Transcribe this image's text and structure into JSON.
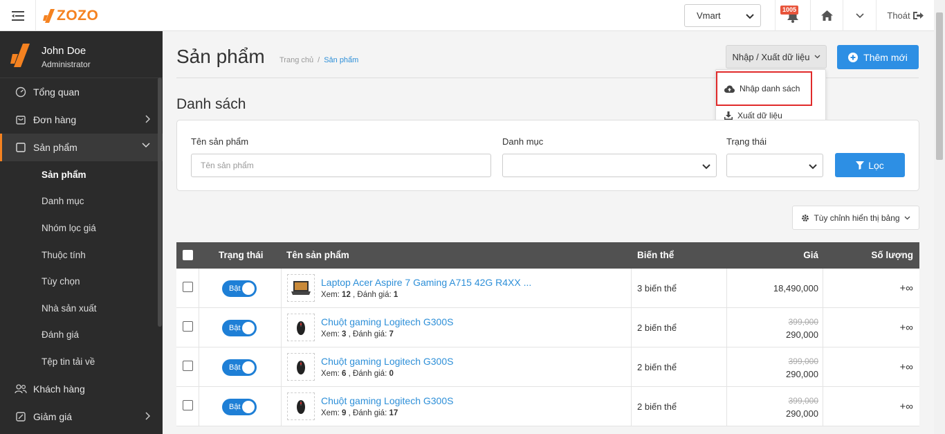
{
  "header": {
    "logo_text": "ZOZO",
    "store_select": "Vmart",
    "notification_count": "1005",
    "logout_label": "Thoát"
  },
  "user": {
    "name": "John Doe",
    "role": "Administrator"
  },
  "sidebar": {
    "items": [
      {
        "label": "Tổng quan",
        "icon": "dashboard-icon"
      },
      {
        "label": "Đơn hàng",
        "icon": "orders-icon"
      },
      {
        "label": "Sản phẩm",
        "icon": "products-icon"
      },
      {
        "label": "Khách hàng",
        "icon": "customers-icon"
      },
      {
        "label": "Giảm giá",
        "icon": "discount-icon"
      }
    ],
    "subitems": [
      "Sản phẩm",
      "Danh mục",
      "Nhóm lọc giá",
      "Thuộc tính",
      "Tùy chọn",
      "Nhà sản xuất",
      "Đánh giá",
      "Tệp tin tải về"
    ]
  },
  "page": {
    "title": "Sản phẩm",
    "breadcrumb": [
      "Trang chủ",
      "/",
      "Sản phẩm"
    ],
    "import_export_label": "Nhập / Xuất dữ liệu",
    "add_new_label": "Thêm mới",
    "dropdown": {
      "import_label": "Nhập danh sách",
      "export_label": "Xuất dữ liệu"
    },
    "section_title": "Danh sách"
  },
  "filters": {
    "name_label": "Tên sản phẩm",
    "name_placeholder": "Tên sản phẩm",
    "category_label": "Danh mục",
    "status_label": "Trạng thái",
    "filter_button": "Lọc",
    "customize_button": "Tùy chỉnh hiển thị bảng"
  },
  "table": {
    "headers": {
      "status": "Trạng thái",
      "name": "Tên sản phẩm",
      "variants": "Biến thể",
      "price": "Giá",
      "quantity": "Số lượng"
    },
    "views_label": "Xem:",
    "rating_label": ", Đánh giá:",
    "rows": [
      {
        "status": "Bật",
        "name": "Laptop Acer Aspire 7 Gaming A715 42G R4XX ...",
        "views": "12",
        "rating": "1",
        "variants": "3 biến thể",
        "price": "18,490,000",
        "old_price": "",
        "qty": "+∞"
      },
      {
        "status": "Bật",
        "name": "Chuột gaming Logitech G300S",
        "views": "3",
        "rating": "7",
        "variants": "2 biến thể",
        "price": "290,000",
        "old_price": "399,000",
        "qty": "+∞"
      },
      {
        "status": "Bật",
        "name": "Chuột gaming Logitech G300S",
        "views": "6",
        "rating": "0",
        "variants": "2 biến thể",
        "price": "290,000",
        "old_price": "399,000",
        "qty": "+∞"
      },
      {
        "status": "Bật",
        "name": "Chuột gaming Logitech G300S",
        "views": "9",
        "rating": "17",
        "variants": "2 biến thể",
        "price": "290,000",
        "old_price": "399,000",
        "qty": "+∞"
      }
    ]
  },
  "colors": {
    "brand_orange": "#f58220",
    "primary_blue": "#2d8fe4",
    "highlight_red": "#e02a2a",
    "sidebar_bg": "#2b2b2b"
  }
}
